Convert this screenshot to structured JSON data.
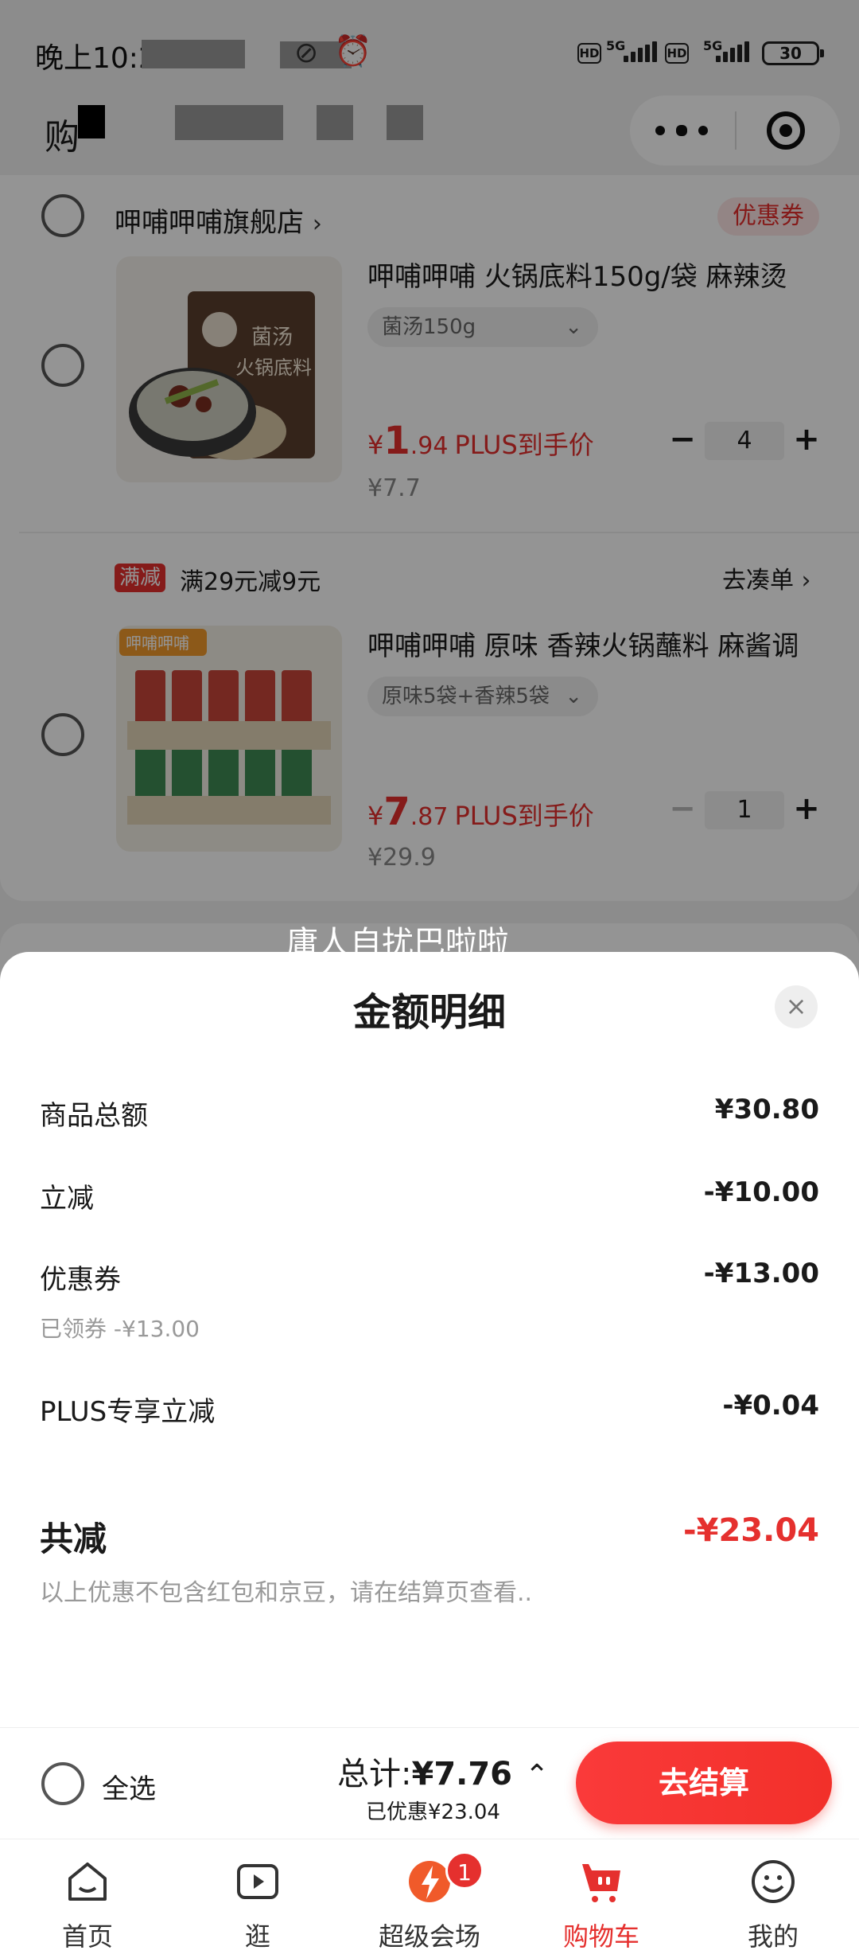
{
  "status_bar": {
    "time": "晚上10:2",
    "battery": "30",
    "hd": "HD",
    "net": "5G"
  },
  "header": {
    "title": "购"
  },
  "shop": {
    "name": "呷哺呷哺旗舰店",
    "coupon_tag": "优惠券"
  },
  "items": [
    {
      "name": "呷哺呷哺 火锅底料150g/袋 麻辣烫",
      "spec": "菌汤150g",
      "price_currency": "¥",
      "price_int": "1",
      "price_dec": ".94",
      "price_label": "PLUS到手价",
      "original_price": "¥7.7",
      "quantity": "4",
      "image_text": "菌汤 火锅底料"
    },
    {
      "name": "呷哺呷哺 原味 香辣火锅蘸料 麻酱调",
      "spec": "原味5袋+香辣5袋",
      "price_currency": "¥",
      "price_int": "7",
      "price_dec": ".87",
      "price_label": "PLUS到手价",
      "original_price": "¥29.9",
      "quantity": "1",
      "image_text": "呷哺呷哺"
    }
  ],
  "promo": {
    "tag": "满减",
    "text": "满29元减9元",
    "link": "去凑单"
  },
  "watermark": "庸人自扰巴啦啦",
  "sheet": {
    "title": "金额明细",
    "close": "×",
    "rows": [
      {
        "label": "商品总额",
        "value": "¥30.80"
      },
      {
        "label": "立减",
        "value": "-¥10.00"
      },
      {
        "label": "优惠券",
        "value": "-¥13.00",
        "sub": "已领券 -¥13.00"
      },
      {
        "label": "PLUS专享立减",
        "value": "-¥0.04"
      }
    ],
    "total_label": "共减",
    "total_value": "-¥23.04",
    "note": "以上优惠不包含红包和京豆，请在结算页查看.."
  },
  "checkout": {
    "select_all": "全选",
    "total_prefix": "总计:",
    "total_value": "¥7.76",
    "saved": "已优惠¥23.04",
    "caret": "⌃",
    "button": "去结算"
  },
  "tabs": [
    {
      "label": "首页",
      "icon": "home-icon"
    },
    {
      "label": "逛",
      "icon": "video-icon"
    },
    {
      "label": "超级会场",
      "icon": "venue-icon",
      "badge": "1"
    },
    {
      "label": "购物车",
      "icon": "cart-icon",
      "active": true
    },
    {
      "label": "我的",
      "icon": "profile-icon"
    }
  ],
  "colors": {
    "accent": "#e5302e",
    "sheet_bg": "#ffffff"
  }
}
